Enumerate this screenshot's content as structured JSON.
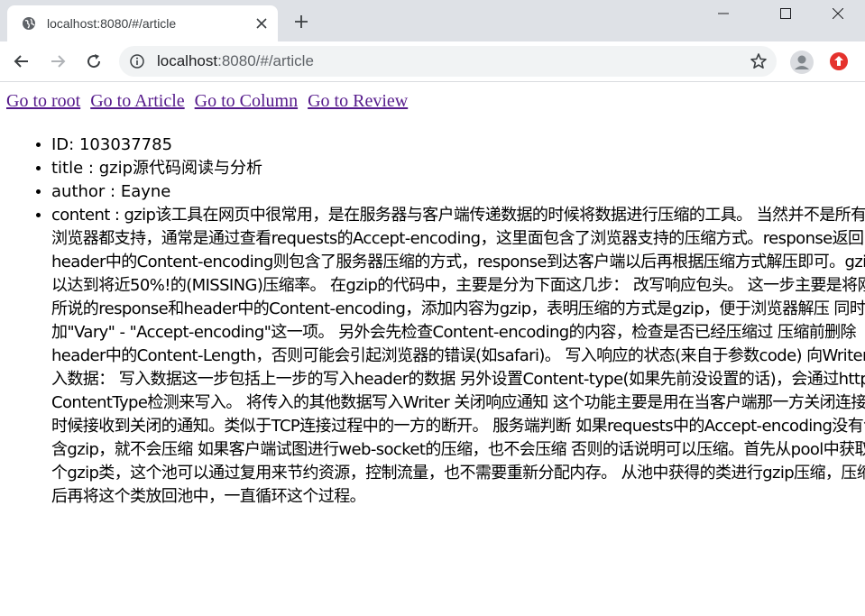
{
  "browser": {
    "tab_title": "localhost:8080/#/article",
    "url_host": "localhost",
    "url_rest": ":8080/#/article"
  },
  "nav_links": [
    "Go to root",
    "Go to Article",
    "Go to Column",
    "Go to Review"
  ],
  "article": {
    "id_label": "ID: ",
    "id": "103037785",
    "title_label": "title : ",
    "title": "gzip源代码阅读与分析",
    "author_label": "author : ",
    "author": "Eayne",
    "content_label": "content : ",
    "content": "gzip该工具在网页中很常用，是在服务器与客户端传递数据的时候将数据进行压缩的工具。 当然并不是所有的浏览器都支持，通常是通过查看requests的Accept-encoding，这里面包含了浏览器支持的压缩方式。response返回的header中的Content-encoding则包含了服务器压缩的方式，response到达客户端以后再根据压缩方式解压即可。gzip可以达到将近50%!的(MISSING)压缩率。 在gzip的代码中，主要是分为下面这几步： 改写响应包头。 这一步主要是将刚刚所说的response和header中的Content-encoding，添加内容为gzip，表明压缩的方式是gzip，便于浏览器解压 同时增加\"Vary\" - \"Accept-encoding\"这一项。 另外会先检查Content-encoding的内容，检查是否已经压缩过 压缩前删除header中的Content-Length，否则可能会引起浏览器的错误(如safari)。 写入响应的状态(来自于参数code) 向Writer写入数据： 写入数据这一步包括上一步的写入header的数据 另外设置Content-type(如果先前没设置的话)，会通过http的ContentType检测来写入。 将传入的其他数据写入Writer 关闭响应通知 这个功能主要是用在当客户端那一方关闭连接的时候接收到关闭的通知。类似于TCP连接过程中的一方的断开。 服务端判断 如果requests中的Accept-encoding没有包含gzip，就不会压缩 如果客户端试图进行web-socket的压缩，也不会压缩 否则的话说明可以压缩。首先从pool中获取一个gzip类，这个池可以通过复用来节约资源，控制流量，也不需要重新分配内存。 从池中获得的类进行gzip压缩，压缩完后再将这个类放回池中，一直循环这个过程。"
  },
  "colors": {
    "tabstrip_bg": "#dee1e6",
    "link_visited": "#551a8b",
    "extension_red": "#e5322d"
  },
  "icons": [
    "globe-icon",
    "close-icon",
    "plus-icon",
    "minimize-icon",
    "maximize-icon",
    "window-close-icon",
    "back-arrow-icon",
    "forward-arrow-icon",
    "reload-icon",
    "info-icon",
    "star-icon",
    "avatar-icon",
    "extension-icon"
  ]
}
